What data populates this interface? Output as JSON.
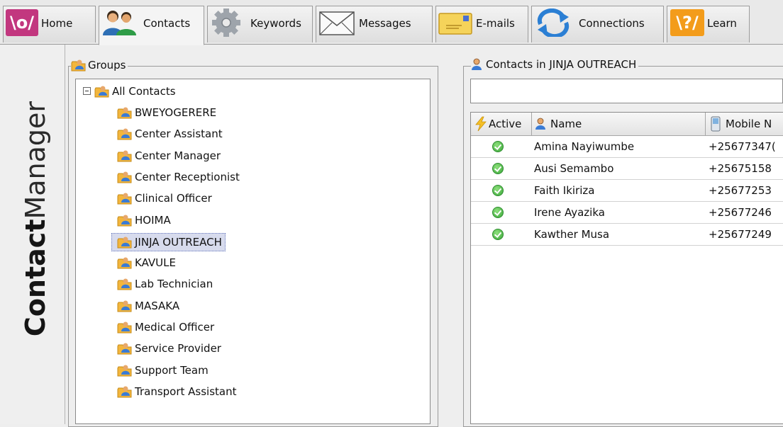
{
  "tabs": [
    {
      "id": "home",
      "label": "Home",
      "icon": "frontline-logo-icon"
    },
    {
      "id": "contacts",
      "label": "Contacts",
      "icon": "contacts-people-icon",
      "active": true
    },
    {
      "id": "keywords",
      "label": "Keywords",
      "icon": "gear-icon"
    },
    {
      "id": "messages",
      "label": "Messages",
      "icon": "envelope-icon"
    },
    {
      "id": "emails",
      "label": "E-mails",
      "icon": "email-icon"
    },
    {
      "id": "connections",
      "label": "Connections",
      "icon": "sync-arrows-icon"
    },
    {
      "id": "learn",
      "label": "Learn",
      "icon": "learn-logo-icon"
    }
  ],
  "brand": {
    "bold": "Contact",
    "light": "Manager"
  },
  "logos": {
    "home": "\\o/",
    "learn": "\\?/"
  },
  "groups": {
    "legend": "Groups",
    "root": "All Contacts",
    "items": [
      "BWEYOGERERE",
      "Center Assistant",
      "Center Manager",
      "Center Receptionist",
      "Clinical Officer",
      "HOIMA",
      "JINJA OUTREACH",
      "KAVULE",
      "Lab Technician",
      "MASAKA",
      "Medical Officer",
      "Service Provider",
      "Support Team",
      "Transport Assistant"
    ],
    "selected": "JINJA OUTREACH"
  },
  "contacts": {
    "legend": "Contacts in JINJA OUTREACH",
    "search_value": "",
    "columns": {
      "active": "Active",
      "name": "Name",
      "mobile": "Mobile N"
    },
    "rows": [
      {
        "active": true,
        "name": "Amina  Nayiwumbe",
        "mobile": "+25677347("
      },
      {
        "active": true,
        "name": "Ausi Semambo",
        "mobile": "+25675158"
      },
      {
        "active": true,
        "name": "Faith Ikiriza",
        "mobile": "+25677253"
      },
      {
        "active": true,
        "name": "Irene  Ayazika",
        "mobile": "+25677246"
      },
      {
        "active": true,
        "name": "Kawther Musa",
        "mobile": "+25677249"
      }
    ]
  },
  "colors": {
    "accent_magenta": "#c2377f",
    "accent_orange": "#f39c1b",
    "selection": "#d7dbed",
    "active_green": "#3aa63a"
  }
}
